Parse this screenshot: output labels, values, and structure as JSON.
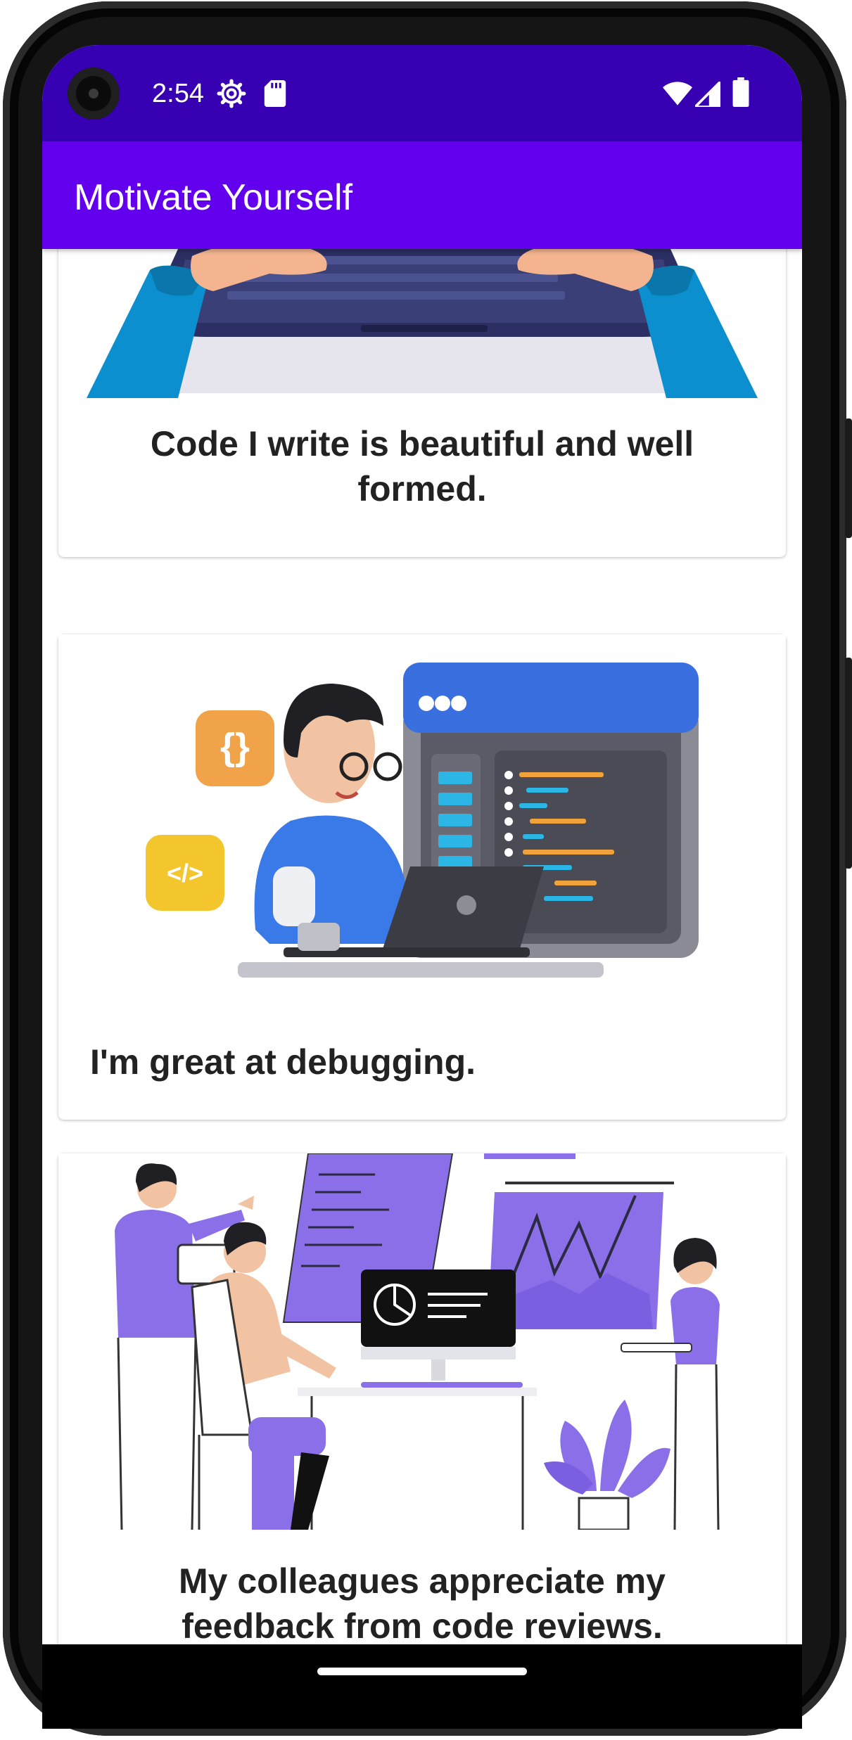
{
  "status_bar": {
    "time": "2:54",
    "left_icons": [
      "settings-gear-icon",
      "sd-card-icon"
    ],
    "right_icons": [
      "wifi-icon",
      "cell-signal-icon",
      "battery-icon"
    ]
  },
  "app_bar": {
    "title": "Motivate Yourself"
  },
  "affirmations": [
    {
      "text": "Code I write is beautiful and well formed.",
      "illustration": "hands-typing-on-laptop"
    },
    {
      "text": "I'm great at debugging.",
      "illustration": "developer-with-laptop-and-code-window"
    },
    {
      "text": "My colleagues appreciate my feedback from code reviews.",
      "illustration": "team-collaborating-at-computer"
    }
  ],
  "colors": {
    "status_bar": "#3700b3",
    "app_bar": "#6200ee",
    "text": "#222222",
    "card": "#ffffff",
    "accent_purple": "#8b6fe8"
  },
  "navigation": {
    "handle": "gesture-nav-handle"
  }
}
